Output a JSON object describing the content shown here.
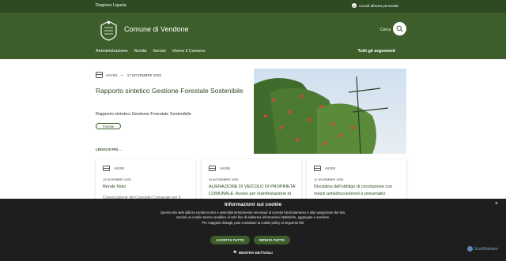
{
  "topbar": {
    "region": "Regione Liguria",
    "login_label": "Accedi all'area personale"
  },
  "header": {
    "site_title": "Comune di Vendone",
    "search_label": "Cerca"
  },
  "nav": {
    "items": [
      "Amministrazione",
      "Novità",
      "Servizi",
      "Vivere il Comune"
    ],
    "all_topics": "Tutti gli argomenti"
  },
  "hero": {
    "category": "AVVISI",
    "separator": "—",
    "date": "17 NOVEMBRE 2025",
    "title": "Rapporto sintetico Gestione Forestale Sostenibile",
    "description": "Rapporto sintetico Gestione Forestale Sostenibile",
    "tag": "Foreste",
    "read_more": "LEGGI DI PIÙ"
  },
  "cards": [
    {
      "category": "AVVISI",
      "date": "13 DICEMBRE 2025",
      "title": "Rende Noto",
      "body": "Convocazione del Consiglio Comunale per il"
    },
    {
      "category": "AVVISI",
      "date": "24 NOVEMBRE 2025",
      "title": "ALIENAZIONE DI VEICOLO DI PROPRIETA' COMUNALE. Avviso per manifestazione di",
      "body": ""
    },
    {
      "category": "AVVISI",
      "date": "11 NOVEMBRE 2025",
      "title": "Disciplina dell'obbligo di circolazione con mezzi antisdrucciolevoli o pneumatici",
      "body": ""
    }
  ],
  "cookie": {
    "title": "Informazioni sui cookie",
    "text": "Questo sito web utilizza cookie tecnici e assimilati strettamente necessari al corretto funzionamento e alla navigazione del sito, nonché un cookie tecnico analitico al solo fine di elaborare informazioni statistiche, aggregate e anonime.",
    "text2": "Per maggiori dettagli, puoi consultare la cookie policy al seguente link",
    "accept": "ACCETTA TUTTO",
    "reject": "RIFIUTA TUTTO",
    "details": "MOSTRA DETTAGLI",
    "close": "×"
  },
  "watermark": "ScanMalware",
  "colors": {
    "topbar": "#2e4a22",
    "header": "#3d5e2b",
    "accent": "#2e4a22",
    "cookie_bg": "#1e1e1e"
  }
}
